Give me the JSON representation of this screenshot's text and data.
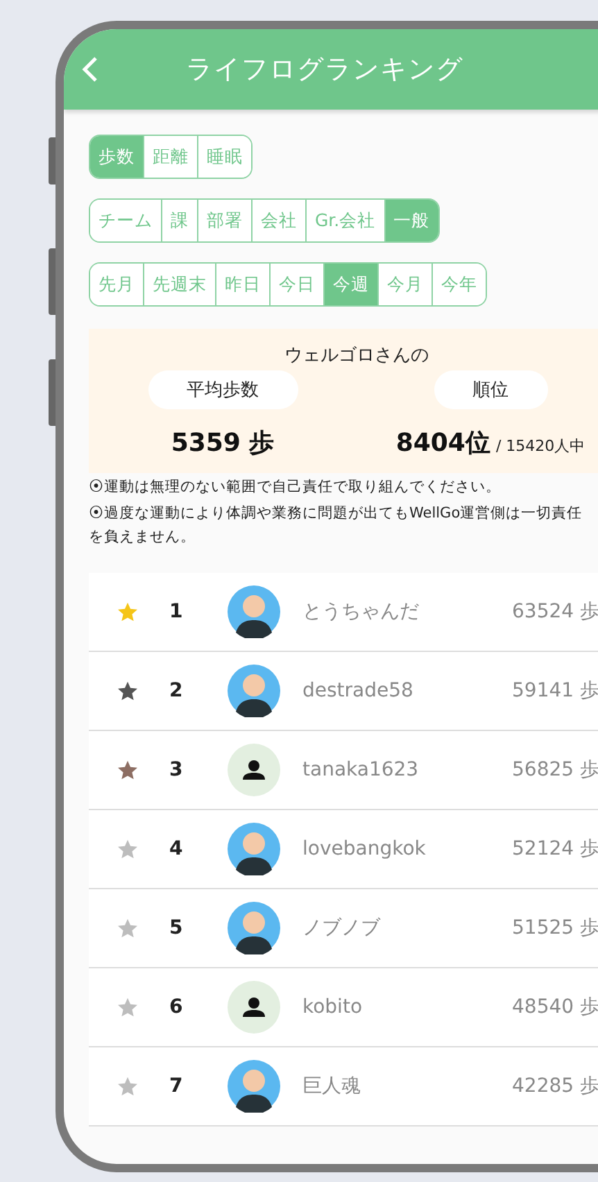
{
  "header": {
    "title": "ライフログランキング"
  },
  "metric_tabs": [
    {
      "label": "歩数",
      "selected": true
    },
    {
      "label": "距離",
      "selected": false
    },
    {
      "label": "睡眠",
      "selected": false
    }
  ],
  "scope_tabs": [
    {
      "label": "チーム",
      "selected": false
    },
    {
      "label": "課",
      "selected": false
    },
    {
      "label": "部署",
      "selected": false
    },
    {
      "label": "会社",
      "selected": false
    },
    {
      "label": "Gr.会社",
      "selected": false
    },
    {
      "label": "一般",
      "selected": true
    }
  ],
  "period_tabs": [
    {
      "label": "先月",
      "selected": false
    },
    {
      "label": "先週末",
      "selected": false
    },
    {
      "label": "昨日",
      "selected": false
    },
    {
      "label": "今日",
      "selected": false
    },
    {
      "label": "今週",
      "selected": true
    },
    {
      "label": "今月",
      "selected": false
    },
    {
      "label": "今年",
      "selected": false
    }
  ],
  "summary": {
    "title": "ウェルゴロさんの",
    "average_label": "平均歩数",
    "rank_label": "順位",
    "average_value": "5359 歩",
    "rank_value": "8404位",
    "rank_total": "/ 15420人中"
  },
  "notes": [
    "⦿運動は無理のない範囲で自己責任で取り組んでください。",
    "⦿過度な運動により体調や業務に問題が出てもWellGo運営側は一切責任を負えません。"
  ],
  "ranking": [
    {
      "rank": "1",
      "name": "とうちゃんだ",
      "steps": "63524 歩",
      "color": "#f5c518",
      "kind": "illustration"
    },
    {
      "rank": "2",
      "name": "destrade58",
      "steps": "59141 歩",
      "color": "#555555",
      "kind": "illustration"
    },
    {
      "rank": "3",
      "name": "tanaka1623",
      "steps": "56825 歩",
      "color": "#8d6e63",
      "kind": "default"
    },
    {
      "rank": "4",
      "name": "lovebangkok",
      "steps": "52124 歩",
      "color": "#bdbdbd",
      "kind": "illustration"
    },
    {
      "rank": "5",
      "name": "ノブノブ",
      "steps": "51525 歩",
      "color": "#bdbdbd",
      "kind": "illustration"
    },
    {
      "rank": "6",
      "name": "kobito",
      "steps": "48540 歩",
      "color": "#bdbdbd",
      "kind": "default"
    },
    {
      "rank": "7",
      "name": "巨人魂",
      "steps": "42285 歩",
      "color": "#bdbdbd",
      "kind": "illustration"
    }
  ]
}
